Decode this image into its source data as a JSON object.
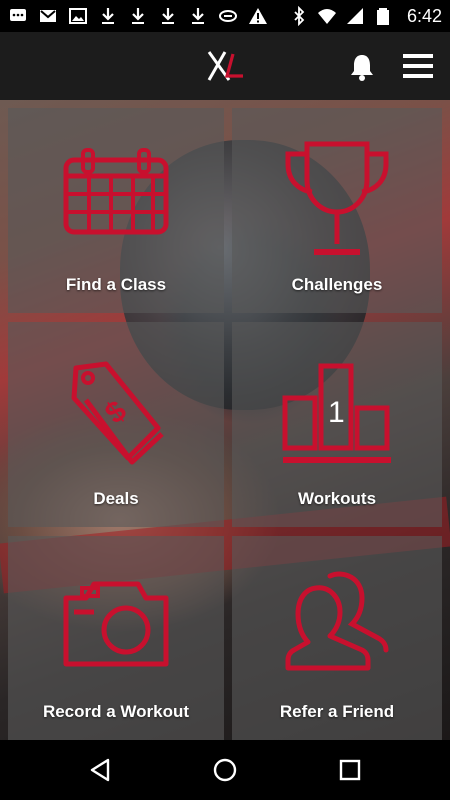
{
  "status_bar": {
    "time": "6:42",
    "left_icons": [
      "chat-icon",
      "gmail-icon",
      "image-icon",
      "download-icon",
      "download-icon",
      "download-icon",
      "download-icon",
      "link-icon",
      "warning-icon"
    ],
    "right_icons": [
      "bluetooth-icon",
      "wifi-icon",
      "signal-icon",
      "battery-icon"
    ]
  },
  "app_bar": {
    "logo_icon": "xl-logo",
    "notification_icon": "bell-icon",
    "menu_icon": "hamburger-menu-icon"
  },
  "tiles": [
    {
      "label": "Find a Class",
      "icon": "calendar-icon"
    },
    {
      "label": "Challenges",
      "icon": "trophy-icon"
    },
    {
      "label": "Deals",
      "icon": "price-tag-icon"
    },
    {
      "label": "Workouts",
      "icon": "podium-icon",
      "badge": "1"
    },
    {
      "label": "Record a Workout",
      "icon": "camera-icon"
    },
    {
      "label": "Refer a Friend",
      "icon": "users-icon"
    }
  ],
  "nav_bar": {
    "back_icon": "back-icon",
    "home_icon": "home-icon",
    "recents_icon": "recents-icon"
  },
  "colors": {
    "accent": "#c8102e",
    "app_bar": "#1c1c1c",
    "tile_overlay": "#585858"
  }
}
